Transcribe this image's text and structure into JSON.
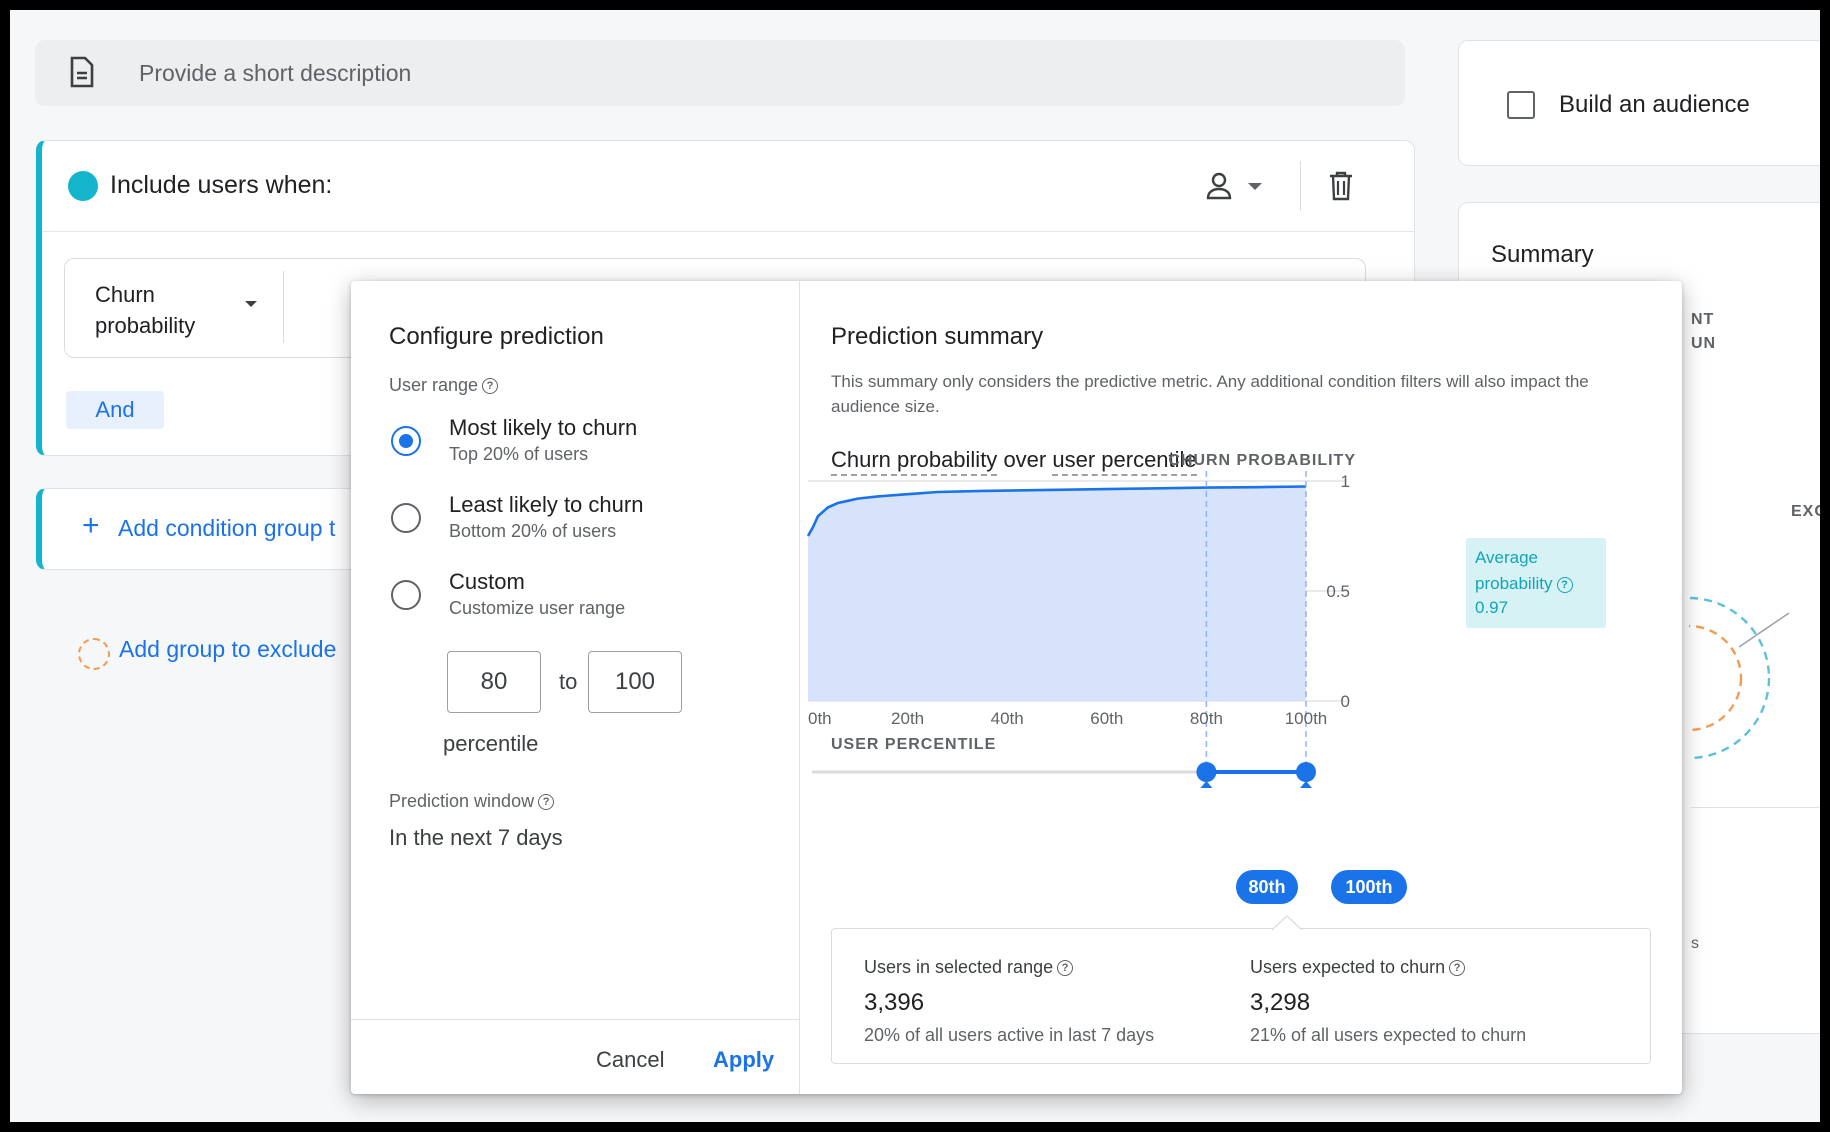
{
  "background": {
    "description_placeholder": "Provide a short description",
    "include_title": "Include users when:",
    "condition_label": "Churn probability",
    "and_label": "And",
    "add_condition_group": "Add condition group t",
    "add_exclude_group": "Add group to exclude",
    "build_audience": "Build an audience",
    "summary_title": "Summary",
    "summary_fragments": [
      "NT",
      "UN",
      "EXC",
      "s"
    ]
  },
  "modal": {
    "config_title": "Configure prediction",
    "user_range_label": "User range",
    "options": [
      {
        "title": "Most likely to churn",
        "sub": "Top 20% of users",
        "selected": true
      },
      {
        "title": "Least likely to churn",
        "sub": "Bottom 20% of users",
        "selected": false
      },
      {
        "title": "Custom",
        "sub": "Customize user range",
        "selected": false
      }
    ],
    "range_from": "80",
    "range_to_word": "to",
    "range_to": "100",
    "percentile_word": "percentile",
    "prediction_window_label": "Prediction window",
    "prediction_window_value": "In the next 7 days",
    "cancel": "Cancel",
    "apply": "Apply",
    "summary_title": "Prediction summary",
    "summary_desc": "This summary only considers the predictive metric. Any additional condition filters will also impact the audience size.",
    "chart_title_a": "Churn probability",
    "chart_title_b": "over",
    "chart_title_c": "user percentile",
    "avg_label": "Average probability",
    "avg_value": "0.97",
    "slider_from": "80th",
    "slider_to": "100th",
    "users_in_range_label": "Users in selected range",
    "users_in_range_value": "3,396",
    "users_in_range_sub": "20% of all users active in last 7 days",
    "expected_churn_label": "Users expected to churn",
    "expected_churn_value": "3,298",
    "expected_churn_sub": "21% of all users expected to churn"
  },
  "colors": {
    "accent": "#1a73e8",
    "teal": "#12b5cb",
    "area_fill": "#d6e3fb"
  },
  "chart_data": {
    "type": "area",
    "title": "",
    "xlabel": "USER PERCENTILE",
    "ylabel": "CHURN PROBABILITY",
    "x_ticks": [
      "0th",
      "20th",
      "40th",
      "60th",
      "80th",
      "100th"
    ],
    "y_ticks": [
      "1",
      "0.5",
      "0"
    ],
    "ylim": [
      0,
      1
    ],
    "xlim": [
      0,
      100
    ],
    "x": [
      0,
      1,
      2,
      4,
      6,
      8,
      10,
      14,
      20,
      26,
      35,
      50,
      65,
      80,
      90,
      100
    ],
    "y": [
      0.75,
      0.79,
      0.84,
      0.88,
      0.9,
      0.91,
      0.92,
      0.93,
      0.94,
      0.95,
      0.955,
      0.96,
      0.965,
      0.97,
      0.972,
      0.975
    ],
    "selected_range": [
      80,
      100
    ]
  }
}
